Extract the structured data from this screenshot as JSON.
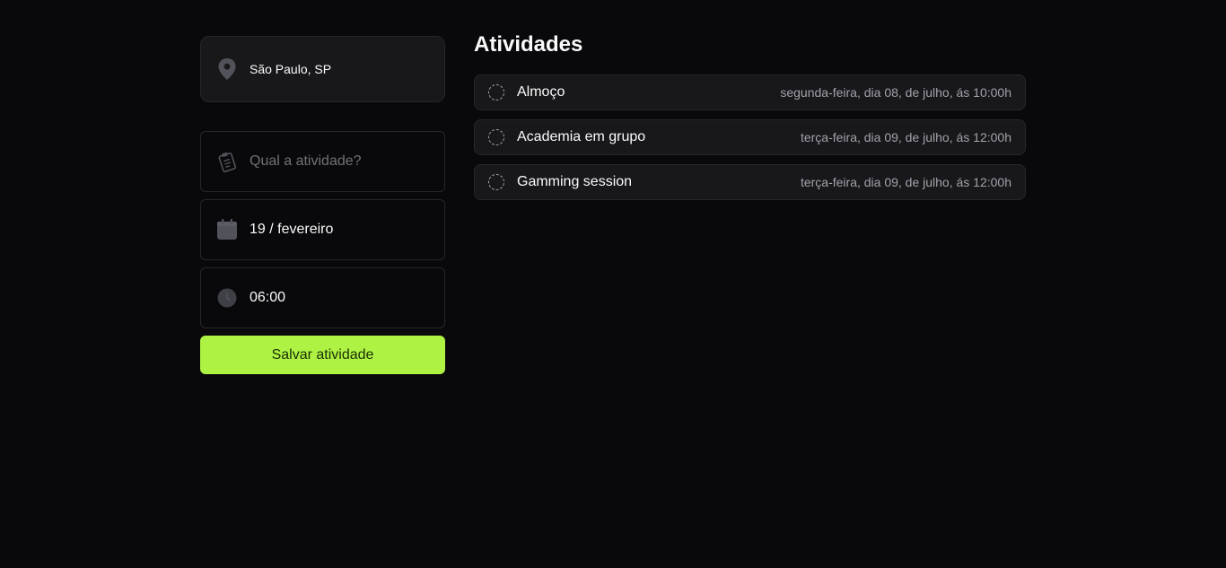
{
  "location": {
    "icon": "map-pin-icon",
    "text": "São Paulo, SP"
  },
  "form": {
    "activity_placeholder": "Qual a atividade?",
    "activity_value": "",
    "activity_icon": "clipboard-icon",
    "date_value": "19 / fevereiro",
    "date_icon": "calendar-icon",
    "time_value": "06:00",
    "time_icon": "clock-icon",
    "save_label": "Salvar atividade"
  },
  "activities": {
    "title": "Atividades",
    "items": [
      {
        "name": "Almoço",
        "date": "segunda-feira, dia 08, de julho, ás 10:00h"
      },
      {
        "name": "Academia em grupo",
        "date": "terça-feira, dia 09, de julho, ás 12:00h"
      },
      {
        "name": "Gamming session",
        "date": "terça-feira, dia 09, de julho, ás 12:00h"
      }
    ]
  },
  "colors": {
    "background": "#09090b",
    "card": "#18181b",
    "border": "#27272a",
    "accent": "#aef244",
    "muted_text": "#a1a1aa"
  }
}
